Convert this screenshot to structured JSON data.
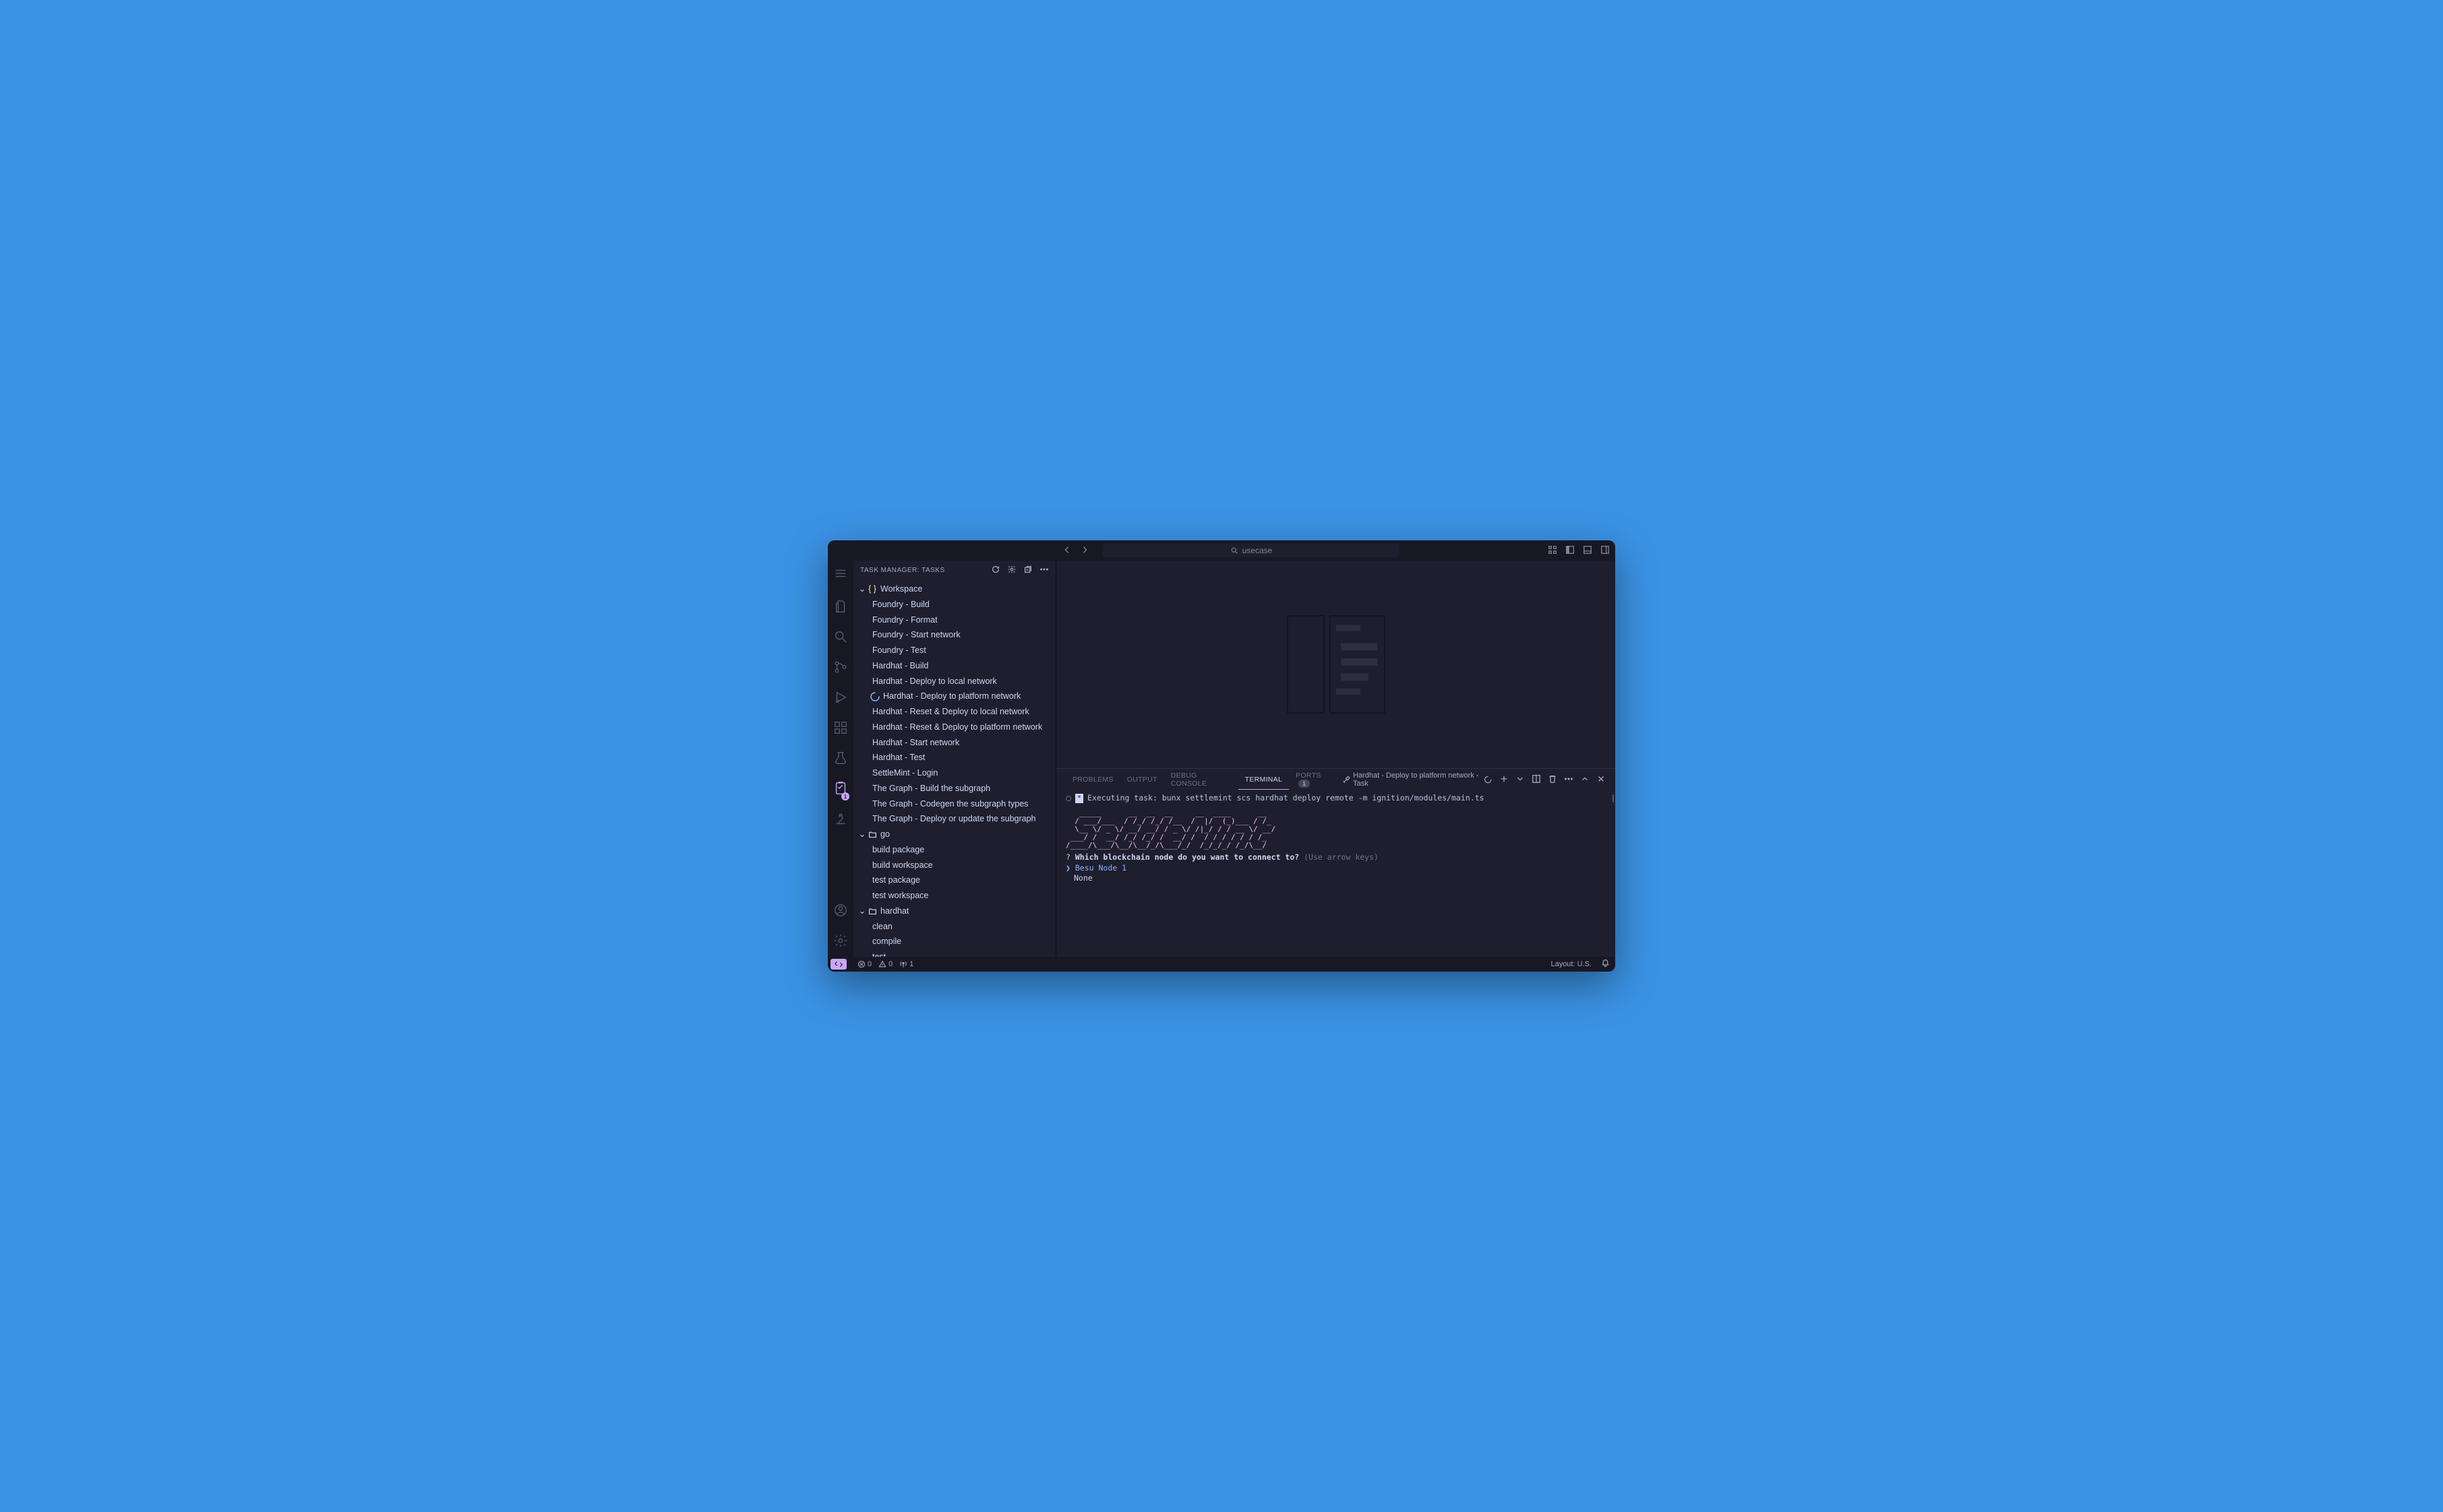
{
  "titlebar": {
    "search_text": "usecase"
  },
  "sidebar": {
    "title": "TASK MANAGER: TASKS",
    "tree": {
      "workspace": {
        "label": "Workspace",
        "tasks": [
          "Foundry - Build",
          "Foundry - Format",
          "Foundry - Start network",
          "Foundry - Test",
          "Hardhat - Build",
          "Hardhat - Deploy to local network",
          "Hardhat - Deploy to platform network",
          "Hardhat - Reset & Deploy to local network",
          "Hardhat - Reset & Deploy to platform network",
          "Hardhat - Start network",
          "Hardhat - Test",
          "SettleMint - Login",
          "The Graph - Build the subgraph",
          "The Graph - Codegen the subgraph types",
          "The Graph - Deploy or update the subgraph"
        ],
        "running_index": 6
      },
      "go": {
        "label": "go",
        "tasks": [
          "build package",
          "build workspace",
          "test package",
          "test workspace"
        ]
      },
      "hardhat": {
        "label": "hardhat",
        "tasks": [
          "clean",
          "compile",
          "test"
        ]
      }
    }
  },
  "activitybar": {
    "task_badge": "1"
  },
  "panel": {
    "tabs": {
      "problems": "PROBLEMS",
      "output": "OUTPUT",
      "debug_console": "DEBUG CONSOLE",
      "terminal": "TERMINAL",
      "ports": "PORTS",
      "ports_count": "1"
    },
    "terminal_name": "Hardhat - Deploy to platform network - Task",
    "exec_line": "Executing task: bunx settlemint scs hardhat deploy remote  -m ignition/modules/main.ts",
    "ascii": "   _____      __  __  __     __  ____      __ \n  / ___/___  / /_/ /_/ /__  /  |/  (_)___ / /_\n  \\__ \\/ _ \\/ __/ __/ / _ \\/ /|_/ / / __ \\/ __/\n ___/ /  __/ /_/ /_/ /  __/ /  / / / / / / /_ \n/____/\\___/\\__/\\__/_/\\___/_/  /_/_/_/ /_/\\__/ ",
    "question": "Which blockchain node do you want to connect to?",
    "hint": "(Use arrow keys)",
    "selected": "Besu Node 1",
    "other_option": "None"
  },
  "statusbar": {
    "errors": "0",
    "warnings": "0",
    "ports": "1",
    "layout": "Layout: U.S."
  }
}
